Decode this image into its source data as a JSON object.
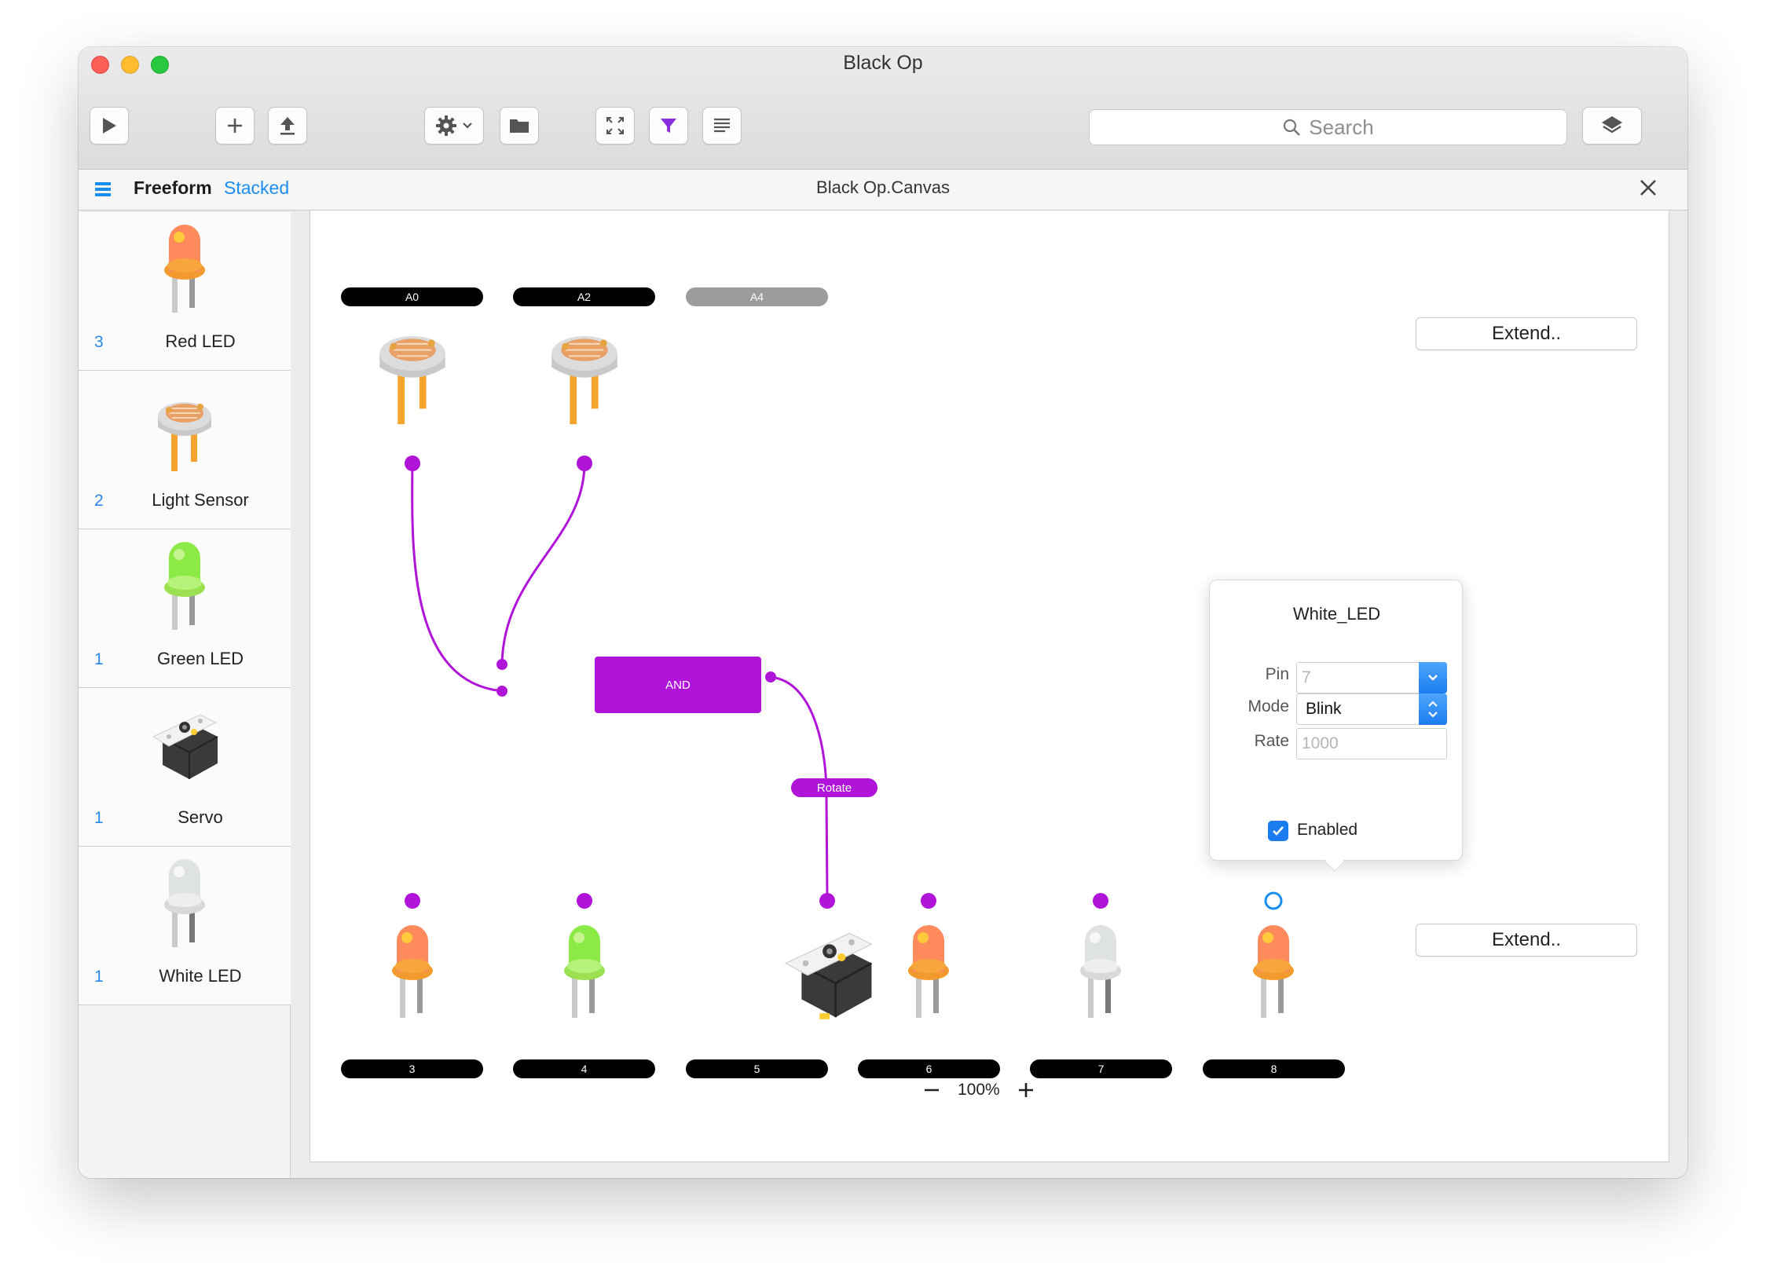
{
  "window": {
    "title": "Black Op"
  },
  "toolbar": {
    "run_icon": "play-icon",
    "add_icon": "plus-icon",
    "upload_icon": "upload-icon",
    "settings_icon": "gear-icon",
    "folder_icon": "folder-icon",
    "fit_icon": "expand-icon",
    "filter_icon": "filter-icon",
    "list_icon": "list-icon",
    "layers_icon": "layers-icon",
    "search_placeholder": "Search",
    "filter_color": "#8a2fe0"
  },
  "tabs": {
    "freeform": "Freeform",
    "stacked": "Stacked",
    "canvas_title": "Black Op.Canvas"
  },
  "sidebar": {
    "items": [
      {
        "count": "3",
        "name": "Red LED",
        "icon": "red-led-icon"
      },
      {
        "count": "2",
        "name": "Light Sensor",
        "icon": "light-sensor-icon"
      },
      {
        "count": "1",
        "name": "Green LED",
        "icon": "green-led-icon"
      },
      {
        "count": "1",
        "name": "Servo",
        "icon": "servo-icon"
      },
      {
        "count": "1",
        "name": "White LED",
        "icon": "white-led-icon"
      }
    ]
  },
  "canvas": {
    "inputs": [
      {
        "label": "A0",
        "active": true
      },
      {
        "label": "A2",
        "active": true
      },
      {
        "label": "A4",
        "active": false
      }
    ],
    "outputs": [
      {
        "label": "3",
        "component": "Red LED"
      },
      {
        "label": "4",
        "component": "Green LED"
      },
      {
        "label": "5",
        "component": "Servo"
      },
      {
        "label": "6",
        "component": "Red LED"
      },
      {
        "label": "7",
        "component": "White LED"
      },
      {
        "label": "8",
        "component": "Red LED"
      }
    ],
    "extend_label": "Extend..",
    "logic_block": "AND",
    "wire_label": "Rotate",
    "wire_color": "#b014d8",
    "open_port_color": "#1a8df0",
    "zoom_level": "100%"
  },
  "popover": {
    "title": "White_LED",
    "pin_label": "Pin",
    "pin_value": "7",
    "mode_label": "Mode",
    "mode_value": "Blink",
    "rate_label": "Rate",
    "rate_placeholder": "1000",
    "enabled_label": "Enabled",
    "enabled": true
  }
}
